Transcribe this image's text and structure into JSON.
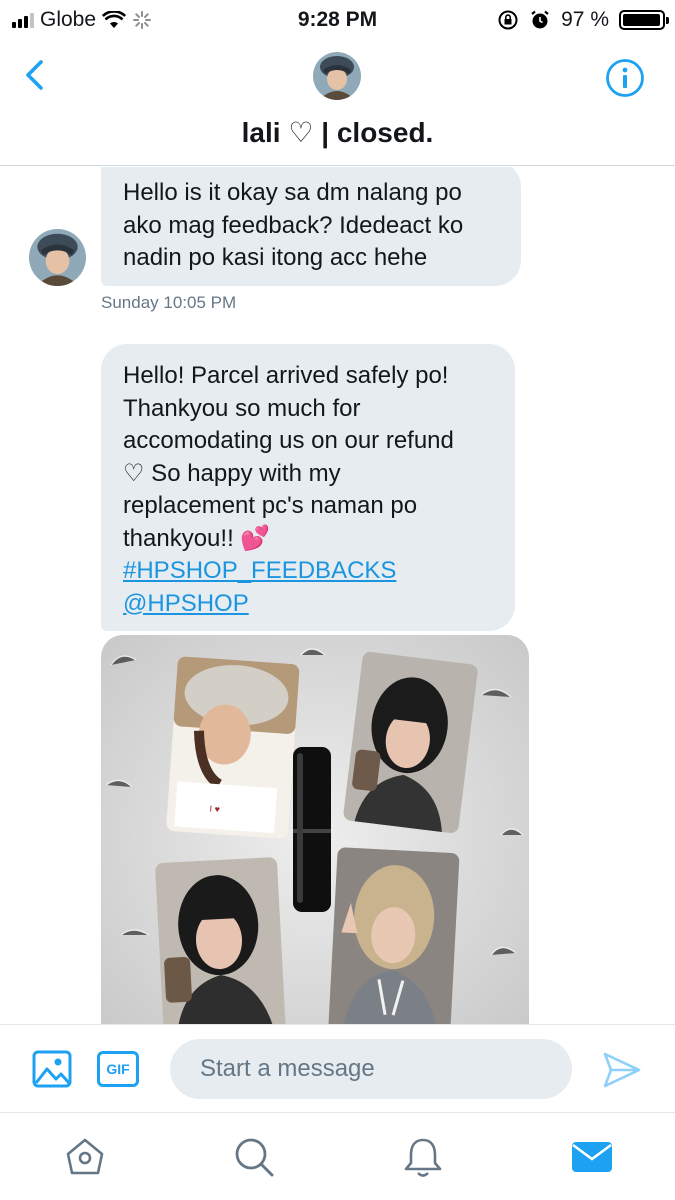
{
  "status_bar": {
    "carrier": "Globe",
    "time": "9:28 PM",
    "battery": "97 %",
    "battery_level": 0.97
  },
  "header": {
    "title": "lali ♡ | closed."
  },
  "messages": [
    {
      "lines": [
        "Hello is it okay sa dm nalang po",
        "ako mag feedback? Idedeact ko",
        "nadin po kasi itong acc hehe"
      ],
      "timestamp": "Sunday 10:05 PM"
    },
    {
      "lines": [
        "Hello! Parcel arrived safely po!",
        "Thankyou so much for",
        "accomodating us on our refund",
        "♡ So happy with my",
        "replacement pc's naman po",
        "thankyou!! 💕"
      ],
      "hashtag": "#HPSHOP_FEEDBACKS",
      "mention": "@HPSHOP"
    }
  ],
  "composer": {
    "gif_label": "GIF",
    "placeholder": "Start a message"
  },
  "colors": {
    "accent": "#1da1f2",
    "bubble": "#e6ecf0",
    "link": "#1b95e0",
    "muted": "#657786"
  }
}
